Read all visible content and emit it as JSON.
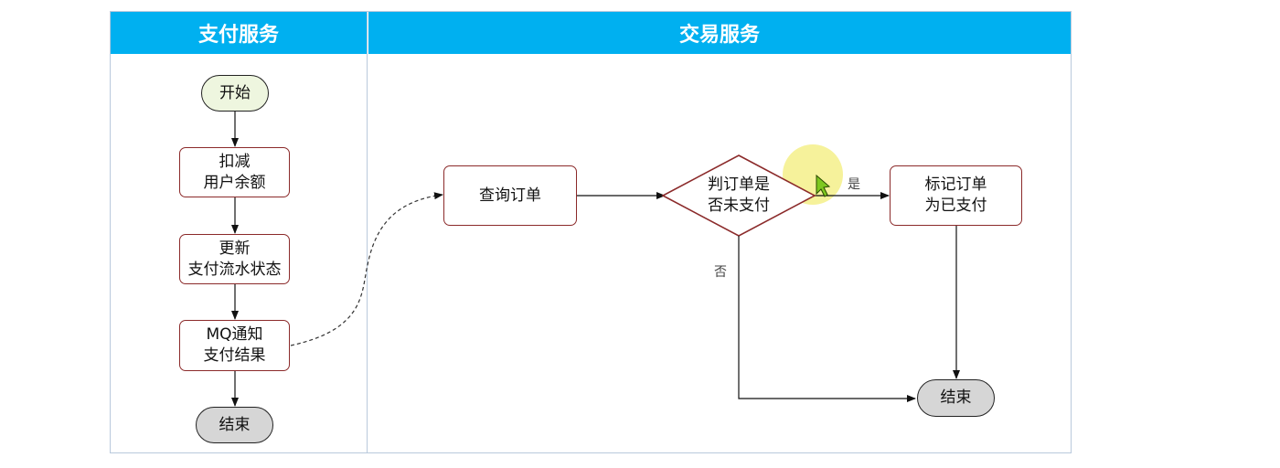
{
  "lanes": {
    "payment": {
      "title": "支付服务"
    },
    "trade": {
      "title": "交易服务"
    }
  },
  "payment_flow": {
    "start": "开始",
    "deduct_balance": "扣减\n用户余额",
    "update_status": "更新\n支付流水状态",
    "mq_notify": "MQ通知\n支付结果",
    "end": "结束"
  },
  "trade_flow": {
    "query_order": "查询订单",
    "decision": "判订单是\n否未支付",
    "yes_label": "是",
    "no_label": "否",
    "mark_paid": "标记订单\n为已支付",
    "end": "结束"
  },
  "colors": {
    "header_bg": "#00b0f0",
    "process_border": "#8b2a2a",
    "start_fill": "#eef6df",
    "end_fill": "#d6d6d6",
    "cursor_highlight": "#f5f08a"
  }
}
